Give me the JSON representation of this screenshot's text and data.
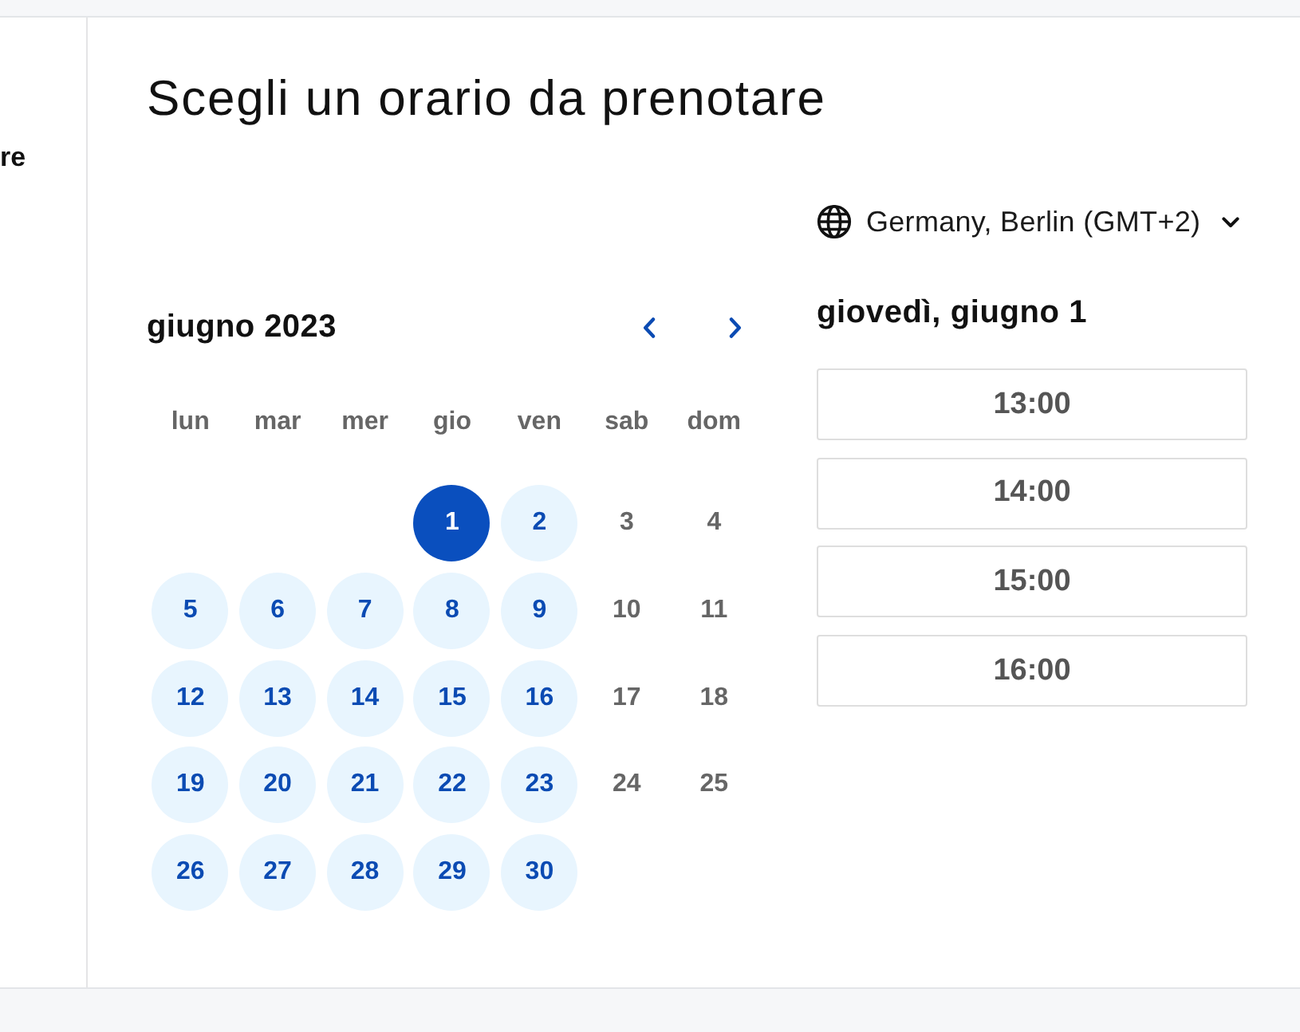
{
  "sidebar": {
    "text": "re"
  },
  "heading": "Scegli un orario da prenotare",
  "timezone": {
    "label": "Germany, Berlin (GMT+2)"
  },
  "calendar": {
    "month": "giugno 2023",
    "weekdays": [
      "lun",
      "mar",
      "mer",
      "gio",
      "ven",
      "sab",
      "dom"
    ],
    "weeks": [
      [
        {
          "label": "1",
          "available": true,
          "selected": true
        },
        {
          "label": "2",
          "available": true,
          "selected": false
        },
        {
          "label": "3",
          "available": false,
          "selected": false
        },
        {
          "label": "4",
          "available": false,
          "selected": false
        }
      ],
      [
        {
          "label": "5",
          "available": true,
          "selected": false
        },
        {
          "label": "6",
          "available": true,
          "selected": false
        },
        {
          "label": "7",
          "available": true,
          "selected": false
        },
        {
          "label": "8",
          "available": true,
          "selected": false
        },
        {
          "label": "9",
          "available": true,
          "selected": false
        },
        {
          "label": "10",
          "available": false,
          "selected": false
        },
        {
          "label": "11",
          "available": false,
          "selected": false
        }
      ],
      [
        {
          "label": "12",
          "available": true,
          "selected": false
        },
        {
          "label": "13",
          "available": true,
          "selected": false
        },
        {
          "label": "14",
          "available": true,
          "selected": false
        },
        {
          "label": "15",
          "available": true,
          "selected": false
        },
        {
          "label": "16",
          "available": true,
          "selected": false
        },
        {
          "label": "17",
          "available": false,
          "selected": false
        },
        {
          "label": "18",
          "available": false,
          "selected": false
        }
      ],
      [
        {
          "label": "19",
          "available": true,
          "selected": false
        },
        {
          "label": "20",
          "available": true,
          "selected": false
        },
        {
          "label": "21",
          "available": true,
          "selected": false
        },
        {
          "label": "22",
          "available": true,
          "selected": false
        },
        {
          "label": "23",
          "available": true,
          "selected": false
        },
        {
          "label": "24",
          "available": false,
          "selected": false
        },
        {
          "label": "25",
          "available": false,
          "selected": false
        }
      ],
      [
        {
          "label": "26",
          "available": true,
          "selected": false
        },
        {
          "label": "27",
          "available": true,
          "selected": false
        },
        {
          "label": "28",
          "available": true,
          "selected": false
        },
        {
          "label": "29",
          "available": true,
          "selected": false
        },
        {
          "label": "30",
          "available": true,
          "selected": false
        }
      ]
    ]
  },
  "selected_date": "giovedì, giugno 1",
  "time_slots": [
    {
      "label": "13:00",
      "selected": false
    },
    {
      "label": "14:00",
      "selected": false
    },
    {
      "label": "15:00",
      "selected": false
    },
    {
      "label": "16:00",
      "selected": false
    }
  ]
}
